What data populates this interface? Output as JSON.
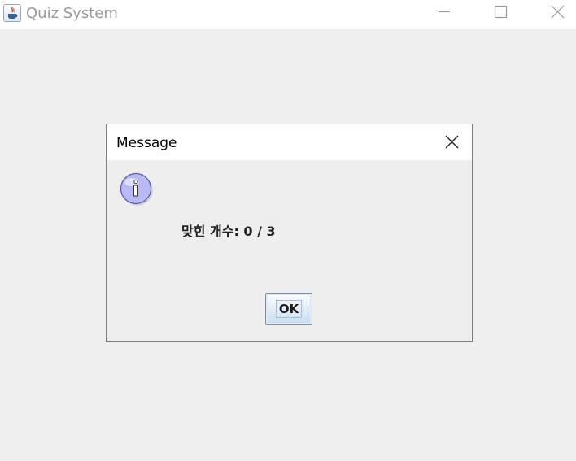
{
  "window": {
    "title": "Quiz System",
    "app_icon": "java-cup-icon",
    "controls": [
      "minimize-icon",
      "maximize-icon",
      "close-icon"
    ]
  },
  "dialog": {
    "title": "Message",
    "icon": "info-icon",
    "message": "맞힌 개수: 0 / 3",
    "ok_label": "OK"
  },
  "colors": {
    "titlebar_bg": "#ffffff",
    "client_bg": "#efefef",
    "dialog_bg": "#eeeeee",
    "info_icon_fill": "#b9b9f4",
    "button_gradient_top": "#fdfeff",
    "button_gradient_bottom": "#c9dcee"
  }
}
